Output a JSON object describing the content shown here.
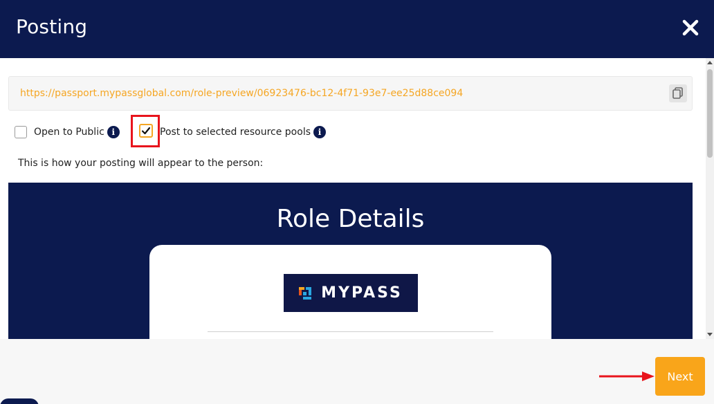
{
  "dialog": {
    "title": "Posting",
    "close_icon": "close-icon"
  },
  "url_box": {
    "url": "https://passport.mypassglobal.com/role-preview/06923476-bc12-4f71-93e7-ee25d88ce094",
    "copy_icon": "copy-icon"
  },
  "options": {
    "open_to_public": {
      "label": "Open to Public",
      "checked": false
    },
    "post_to_pools": {
      "label": "Post to selected resource pools",
      "checked": true
    }
  },
  "preview_note": "This is how your posting will appear to the person:",
  "preview": {
    "heading": "Role Details",
    "logo_text": "MYPASS"
  },
  "footer": {
    "next_label": "Next"
  },
  "colors": {
    "header_bg": "#0c1a4f",
    "accent": "#f9a51a",
    "url_text": "#f5a623",
    "highlight": "#e8141c"
  }
}
